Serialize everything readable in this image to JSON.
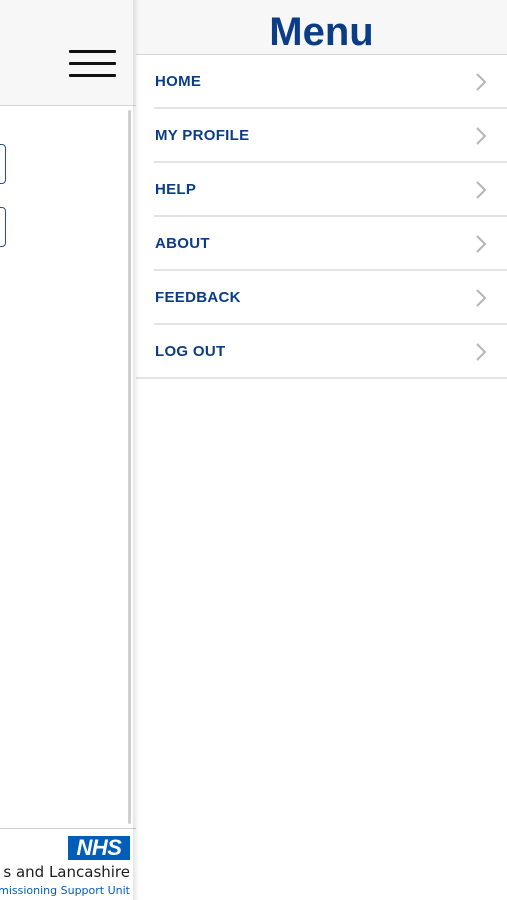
{
  "menu": {
    "title": "Menu",
    "items": [
      {
        "label": "HOME",
        "icon": "chevron-right-icon"
      },
      {
        "label": "MY PROFILE",
        "icon": "chevron-right-icon"
      },
      {
        "label": "HELP",
        "icon": "chevron-right-icon"
      },
      {
        "label": "ABOUT",
        "icon": "chevron-right-icon"
      },
      {
        "label": "FEEDBACK",
        "icon": "chevron-right-icon"
      },
      {
        "label": "LOG OUT",
        "icon": "chevron-right-icon"
      }
    ]
  },
  "main": {
    "hamburger_icon": "hamburger-menu-icon"
  },
  "footer": {
    "logo_text": "NHS",
    "org_line1": "s and Lancashire",
    "org_line2": "missioning Support Unit"
  },
  "colors": {
    "brand_navy": "#0b3d86",
    "nhs_blue": "#005eb8",
    "header_bg": "#f7f7f7",
    "divider": "#e3e3e3"
  }
}
